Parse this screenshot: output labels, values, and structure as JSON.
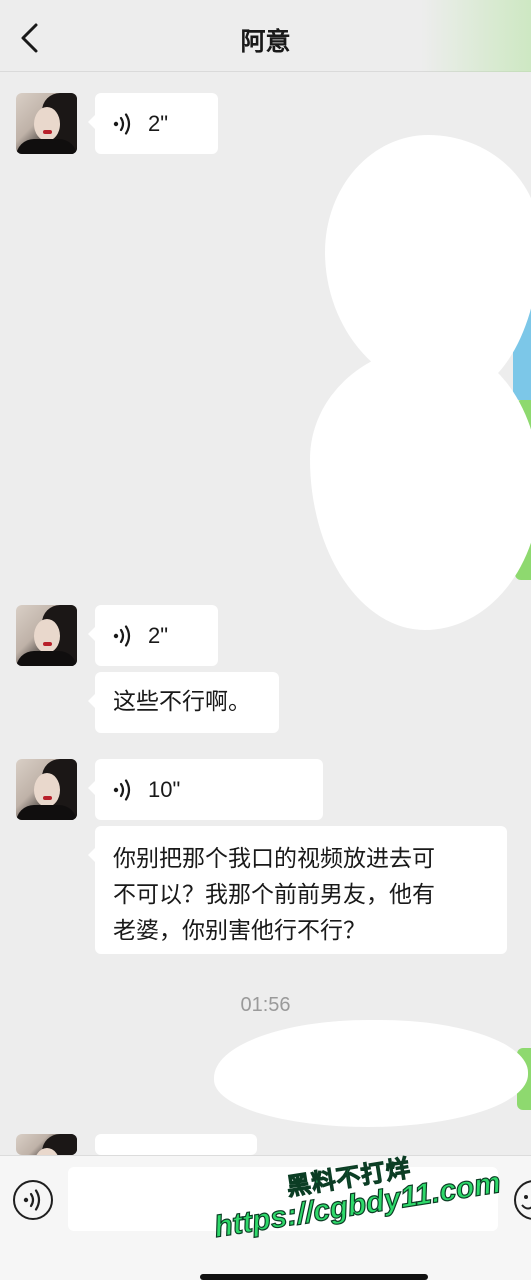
{
  "header": {
    "title": "阿意",
    "back_icon": "chevron-left-icon"
  },
  "messages": [
    {
      "type": "voice",
      "duration": "2\"",
      "icon": "voice-wave-icon"
    },
    {
      "type": "voice",
      "duration": "2\"",
      "icon": "voice-wave-icon"
    },
    {
      "type": "text",
      "text": "这些不行啊。"
    },
    {
      "type": "voice",
      "duration": "10\"",
      "icon": "voice-wave-icon"
    },
    {
      "type": "text",
      "lines": [
        "你别把那个我口的视频放进去可",
        "不可以？我那个前前男友，他有",
        "老婆，你别害他行不行？"
      ]
    }
  ],
  "timestamp": "01:56",
  "input_bar": {
    "voice_icon": "voice-mode-icon",
    "emoji_icon": "emoji-icon"
  },
  "watermark": {
    "line1": "黑料不打烊",
    "line2": "https://cgbdy11.com"
  },
  "colors": {
    "background": "#ededed",
    "bubble": "#ffffff",
    "accent_green": "#8ed96f",
    "watermark_green": "#2ed96a"
  }
}
